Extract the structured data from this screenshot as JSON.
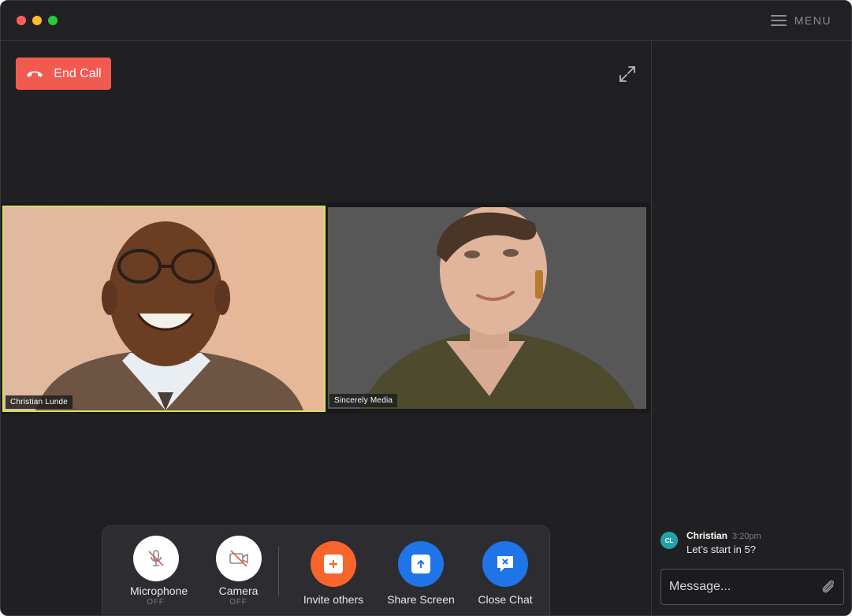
{
  "menu": {
    "label": "MENU"
  },
  "call": {
    "end_label": "End Call"
  },
  "participants": [
    {
      "name": "Christian Lunde"
    },
    {
      "name": "Sincerely Media"
    }
  ],
  "toolbar": {
    "microphone": {
      "label": "Microphone",
      "state": "OFF"
    },
    "camera": {
      "label": "Camera",
      "state": "OFF"
    },
    "invite": {
      "label": "Invite others"
    },
    "share": {
      "label": "Share Screen"
    },
    "chat": {
      "label": "Close Chat"
    }
  },
  "chat": {
    "messages": [
      {
        "initials": "CL",
        "author": "Christian",
        "time": "3:20pm",
        "text": "Let’s start in 5?"
      }
    ],
    "input_placeholder": "Message..."
  },
  "colors": {
    "end_call": "#f25a51",
    "active_speaker_border": "#d5e35b",
    "invite": "#f7652c",
    "share": "#1f74e8",
    "close_chat": "#1f74e8",
    "avatar": "#23a3a8"
  }
}
